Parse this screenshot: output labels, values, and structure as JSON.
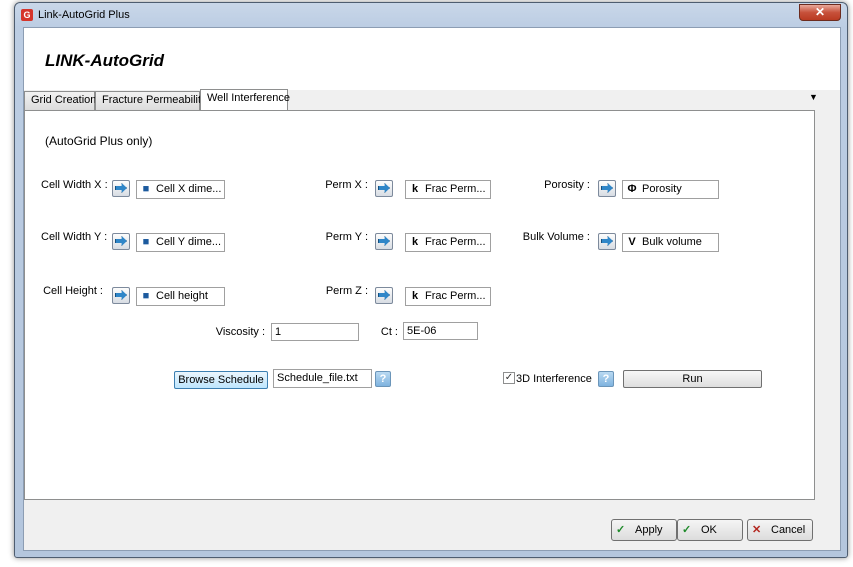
{
  "window": {
    "title": "Link-AutoGrid Plus",
    "app_icon": "G",
    "close": "✕"
  },
  "header": {
    "title": "LINK-AutoGrid"
  },
  "tabs": [
    {
      "label": "Grid Creation",
      "active": false
    },
    {
      "label": "Fracture Permeability",
      "active": false
    },
    {
      "label": "Well Interference",
      "active": true
    }
  ],
  "tab_dropdown": "▼",
  "panel": {
    "note": "(AutoGrid Plus only)",
    "cell_width_x": {
      "label": "Cell Width X :",
      "value": "Cell X dime...",
      "icon": "cube-icon"
    },
    "cell_width_y": {
      "label": "Cell Width Y :",
      "value": "Cell Y dime...",
      "icon": "cube-icon"
    },
    "cell_height": {
      "label": "Cell Height :",
      "value": "Cell height",
      "icon": "cube-icon"
    },
    "perm_x": {
      "label": "Perm X :",
      "value": "Frac Perm...",
      "icon": "permeability-icon",
      "symbol": "k"
    },
    "perm_y": {
      "label": "Perm Y :",
      "value": "Frac Perm...",
      "icon": "permeability-icon",
      "symbol": "k"
    },
    "perm_z": {
      "label": "Perm Z :",
      "value": "Frac Perm...",
      "icon": "permeability-icon",
      "symbol": "k"
    },
    "porosity": {
      "label": "Porosity :",
      "value": "Porosity",
      "icon": "phi-icon",
      "symbol": "Φ"
    },
    "bulk_volume": {
      "label": "Bulk Volume :",
      "value": "Bulk volume",
      "icon": "bulk-volume-icon",
      "symbol": "V"
    },
    "viscosity": {
      "label": "Viscosity :",
      "value": "1"
    },
    "ct": {
      "label": "Ct :",
      "value": "5E-06"
    },
    "browse": {
      "label": "Browse Schedule",
      "file": "Schedule_file.txt"
    },
    "interference": {
      "label": "3D Interference",
      "checked": true
    },
    "run": {
      "label": "Run"
    },
    "help": "?"
  },
  "footer": {
    "apply": "Apply",
    "ok": "OK",
    "cancel": "Cancel"
  },
  "colors": {
    "accent": "#2f86c8",
    "title_bar": "#bccde3",
    "close": "#c7513b"
  }
}
